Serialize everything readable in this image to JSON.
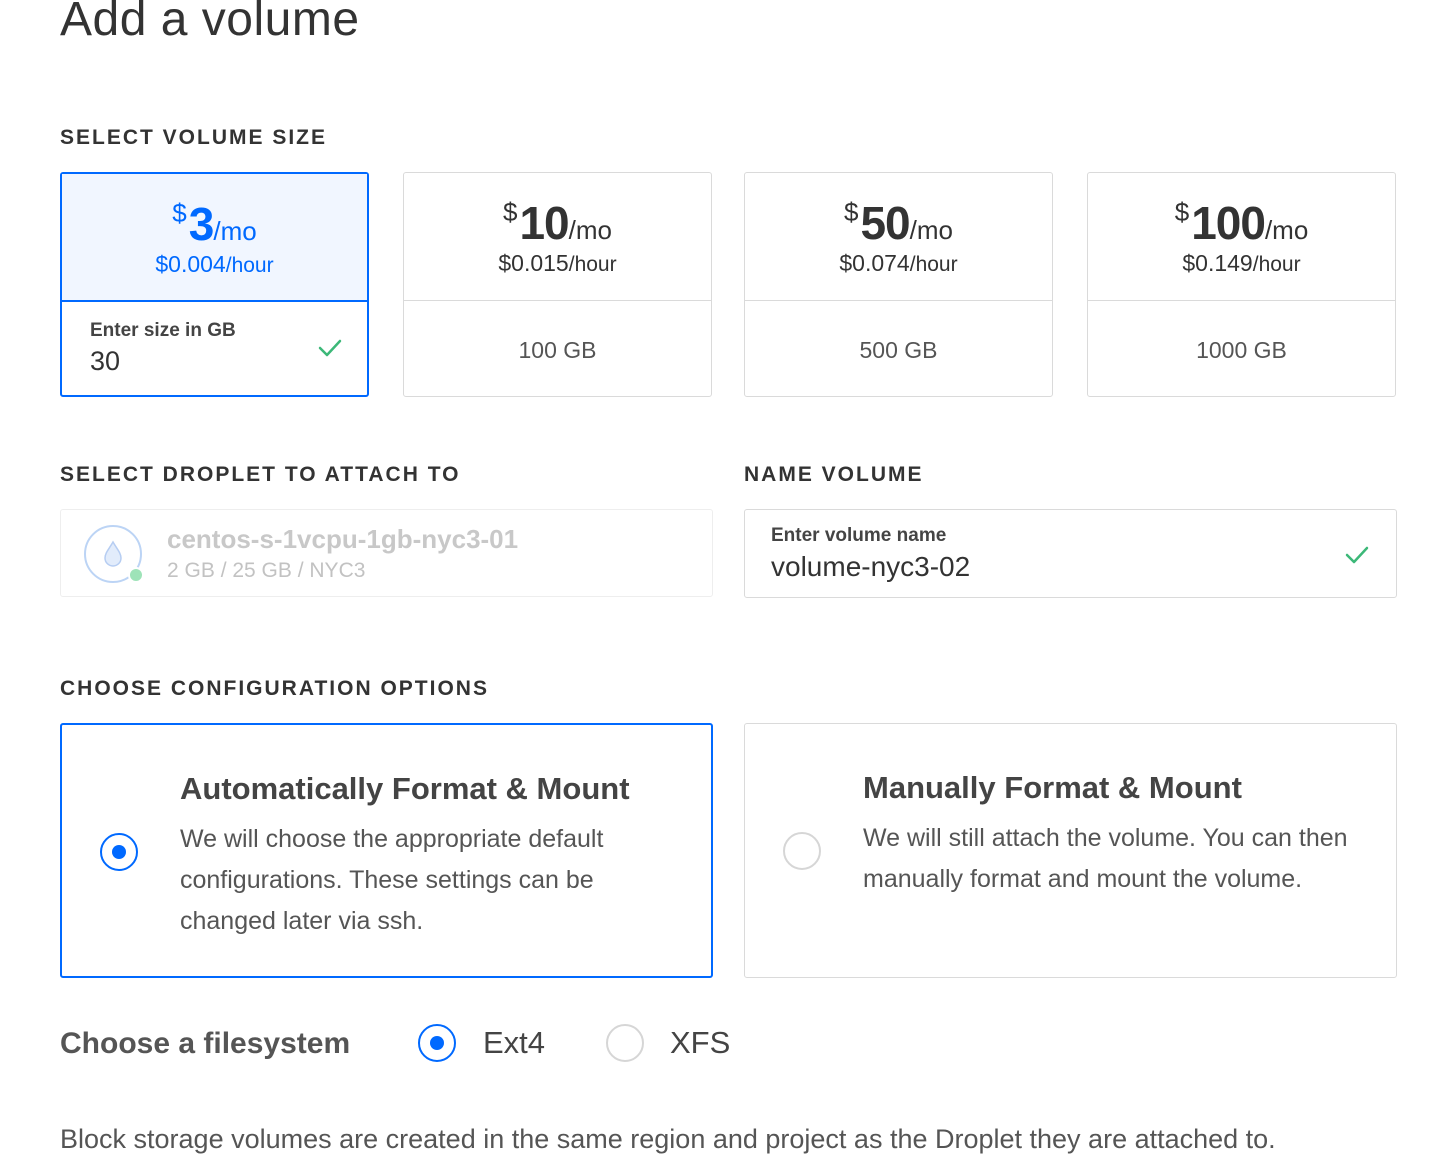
{
  "page": {
    "title": "Add a volume"
  },
  "sections": {
    "size": "SELECT VOLUME SIZE",
    "droplet": "SELECT DROPLET TO ATTACH TO",
    "name": "NAME VOLUME",
    "config": "CHOOSE CONFIGURATION OPTIONS"
  },
  "sizes": [
    {
      "currency": "$",
      "amount": "3",
      "per_month": "/mo",
      "hourly": "$0.004",
      "per_hour": "/hour",
      "selected": true,
      "input_label": "Enter size in GB",
      "input_value": "30"
    },
    {
      "currency": "$",
      "amount": "10",
      "per_month": "/mo",
      "hourly": "$0.015",
      "per_hour": "/hour",
      "gb": "100 GB"
    },
    {
      "currency": "$",
      "amount": "50",
      "per_month": "/mo",
      "hourly": "$0.074",
      "per_hour": "/hour",
      "gb": "500 GB"
    },
    {
      "currency": "$",
      "amount": "100",
      "per_month": "/mo",
      "hourly": "$0.149",
      "per_hour": "/hour",
      "gb": "1000 GB"
    }
  ],
  "droplet": {
    "name": "centos-s-1vcpu-1gb-nyc3-01",
    "meta": "2 GB / 25 GB / NYC3"
  },
  "volume_name": {
    "label": "Enter volume name",
    "value": "volume-nyc3-02"
  },
  "config_options": [
    {
      "title": "Automatically Format & Mount",
      "description": "We will choose the appropriate default configurations. These settings can be changed later via ssh.",
      "selected": true
    },
    {
      "title": "Manually Format & Mount",
      "description": "We will still attach the volume. You can then manually format and mount the volume.",
      "selected": false
    }
  ],
  "filesystem": {
    "label": "Choose a filesystem",
    "options": [
      {
        "label": "Ext4",
        "selected": true
      },
      {
        "label": "XFS",
        "selected": false
      }
    ]
  },
  "footer_note": "Block storage volumes are created in the same region and project as the Droplet they are attached to.",
  "colors": {
    "accent": "#0069ff",
    "success": "#3cb878",
    "border": "#dadada",
    "selected_bg": "#f1f6ff"
  },
  "icons": {
    "check": "check-icon",
    "droplet": "droplet-icon"
  }
}
